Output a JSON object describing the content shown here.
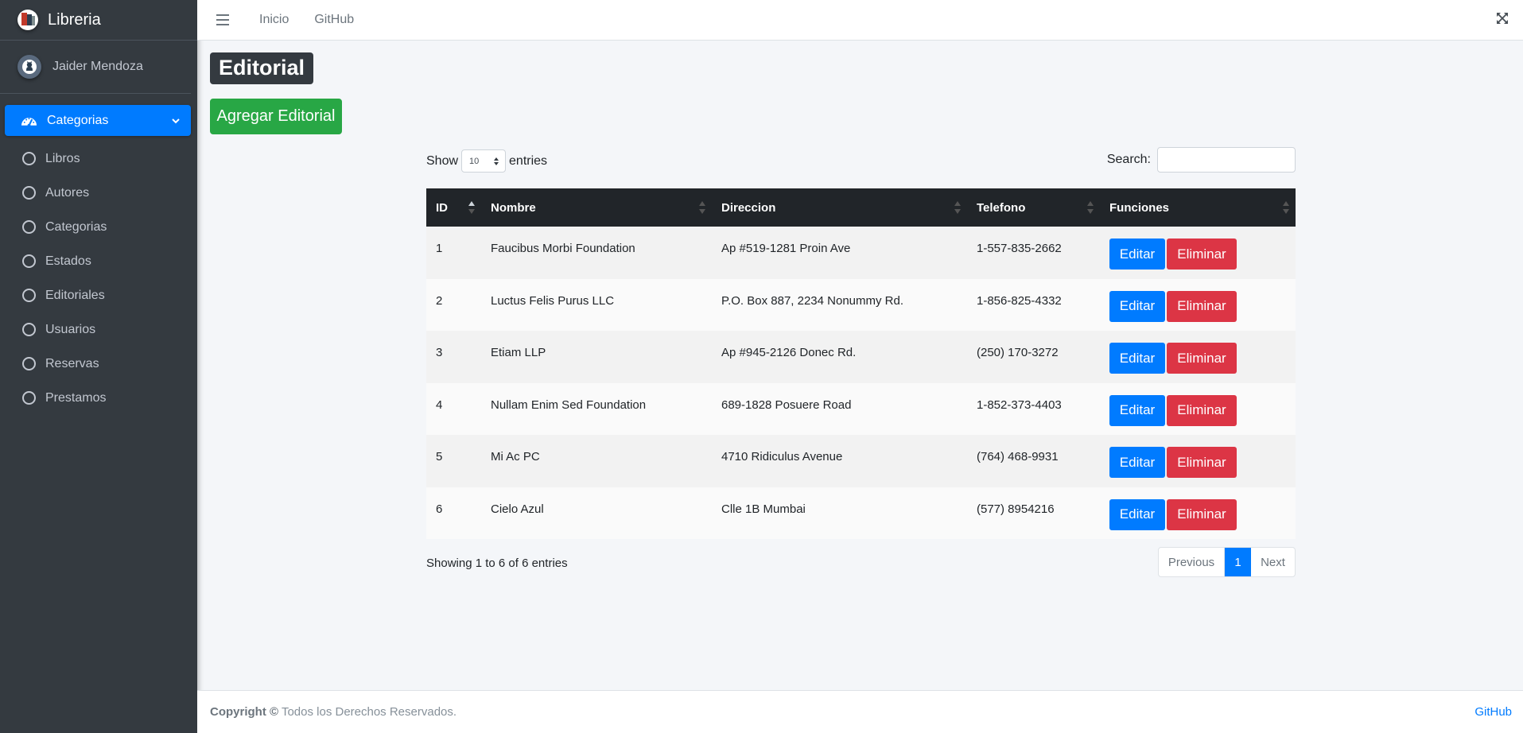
{
  "brand": {
    "name": "Libreria"
  },
  "user": {
    "name": "Jaider Mendoza"
  },
  "sidebar": {
    "active": {
      "label": "Categorias",
      "icon": "tachometer-icon"
    },
    "items": [
      {
        "label": "Libros"
      },
      {
        "label": "Autores"
      },
      {
        "label": "Categorias"
      },
      {
        "label": "Estados"
      },
      {
        "label": "Editoriales"
      },
      {
        "label": "Usuarios"
      },
      {
        "label": "Reservas"
      },
      {
        "label": "Prestamos"
      }
    ]
  },
  "topbar": {
    "links": [
      "Inicio",
      "GitHub"
    ]
  },
  "page": {
    "title": "Editorial",
    "add_button": "Agregar Editorial"
  },
  "datatable": {
    "show_label": "Show",
    "entries_label": "entries",
    "length_value": "10",
    "search_label": "Search:",
    "search_value": "",
    "columns": [
      "ID",
      "Nombre",
      "Direccion",
      "Telefono",
      "Funciones"
    ],
    "rows": [
      {
        "id": "1",
        "nombre": "Faucibus Morbi Foundation",
        "direccion": "Ap #519-1281 Proin Ave",
        "telefono": "1-557-835-2662"
      },
      {
        "id": "2",
        "nombre": "Luctus Felis Purus LLC",
        "direccion": "P.O. Box 887, 2234 Nonummy Rd.",
        "telefono": "1-856-825-4332"
      },
      {
        "id": "3",
        "nombre": "Etiam LLP",
        "direccion": "Ap #945-2126 Donec Rd.",
        "telefono": "(250) 170-3272"
      },
      {
        "id": "4",
        "nombre": "Nullam Enim Sed Foundation",
        "direccion": "689-1828 Posuere Road",
        "telefono": "1-852-373-4403"
      },
      {
        "id": "5",
        "nombre": "Mi Ac PC",
        "direccion": "4710 Ridiculus Avenue",
        "telefono": "(764) 468-9931"
      },
      {
        "id": "6",
        "nombre": "Cielo Azul",
        "direccion": "Clle 1B Mumbai",
        "telefono": "(577) 8954216"
      }
    ],
    "edit_label": "Editar",
    "delete_label": "Eliminar",
    "info": "Showing 1 to 6 of 6 entries",
    "pager": {
      "previous": "Previous",
      "current": "1",
      "next": "Next"
    }
  },
  "footer": {
    "copyright_bold": "Copyright ©",
    "copyright_text": " Todos los Derechos Reservados.",
    "link": "GitHub"
  },
  "colors": {
    "primary": "#007bff",
    "success": "#28a745",
    "danger": "#dc3545",
    "sidebar": "#343a40",
    "table_head": "#212529"
  }
}
